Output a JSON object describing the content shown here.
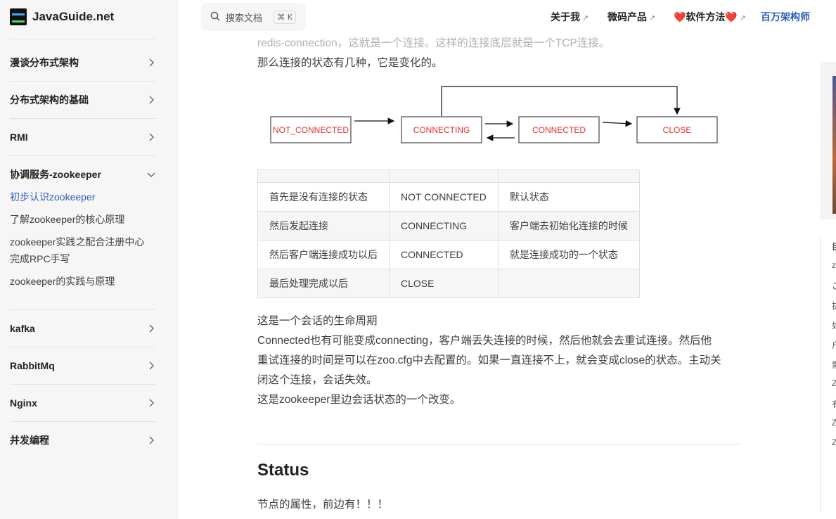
{
  "site": {
    "name": "JavaGuide.net"
  },
  "sidebar": {
    "sections": [
      {
        "label": "漫谈分布式架构"
      },
      {
        "label": "分布式架构的基础"
      },
      {
        "label": "RMI"
      },
      {
        "label": "协调服务-zookeeper",
        "expanded": true
      },
      {
        "label": "kafka"
      },
      {
        "label": "RabbitMq"
      },
      {
        "label": "Nginx"
      },
      {
        "label": "并发编程"
      }
    ],
    "zookeeper_items": [
      {
        "label": "初步认识zookeeper",
        "active": true
      },
      {
        "label": "了解zookeeper的核心原理"
      },
      {
        "label": "zookeeper实践之配合注册中心",
        "label2": "完成RPC手写"
      },
      {
        "label": "zookeeper的实践与原理"
      }
    ]
  },
  "nav": {
    "search_placeholder": "搜索文档",
    "shortcut": "⌘ K",
    "links": [
      {
        "label": "关于我",
        "external": true
      },
      {
        "label": "微码产品",
        "external": true
      },
      {
        "label": "❤️软件方法❤️",
        "external": true
      },
      {
        "label": "百万架构师",
        "external": false
      }
    ],
    "external_arrow": "↗"
  },
  "article": {
    "faded_line": "redis-connection，这就是一个连接。这样的连接底层就是一个TCP连接。",
    "intro": "那么连接的状态有几种，它是变化的。",
    "diagram_states": [
      "NOT_CONNECTED",
      "CONNECTING",
      "CONNECTED",
      "CLOSE"
    ],
    "table": {
      "rows": [
        [
          "首先是没有连接的状态",
          "NOT CONNECTED",
          "默认状态"
        ],
        [
          "然后发起连接",
          "CONNECTING",
          "客户端去初始化连接的时候"
        ],
        [
          "然后客户端连接成功以后",
          "CONNECTED",
          "就是连接成功的一个状态"
        ],
        [
          "最后处理完成以后",
          "CLOSE",
          ""
        ]
      ]
    },
    "paragraphs": [
      "这是一个会话的生命周期",
      "Connected也有可能变成connecting，客户端丢失连接的时候，然后他就会去重试连接。然后他",
      "重试连接的时间是可以在zoo.cfg中去配置的。如果一直连接不上，就会变成close的状态。主动关",
      "闭这个连接，会话失效。",
      "这是zookeeper里边会话状态的一个改变。"
    ],
    "status_heading": "Status",
    "status_text": "节点的属性，前边有！！！"
  },
  "outline_glyphs": [
    "目",
    "z",
    "こ",
    "抜",
    "如",
    "户",
    "需",
    "Z",
    "有",
    "Z",
    "Z"
  ],
  "colors": {
    "brand": "#2c5fb8",
    "state_text": "#e0312e"
  }
}
